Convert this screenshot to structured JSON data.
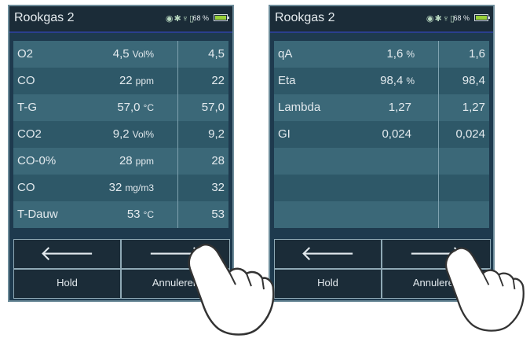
{
  "left": {
    "title": "Rookgas 2",
    "status_icons": "◉✱♆▯",
    "battery_pct": "68 %",
    "rows": [
      {
        "name": "O2",
        "value": "4,5",
        "unit": "Vol%",
        "num": "4,5"
      },
      {
        "name": "CO",
        "value": "22",
        "unit": "ppm",
        "num": "22"
      },
      {
        "name": "T-G",
        "value": "57,0",
        "unit": "°C",
        "num": "57,0"
      },
      {
        "name": "CO2",
        "value": "9,2",
        "unit": "Vol%",
        "num": "9,2"
      },
      {
        "name": "CO-0%",
        "value": "28",
        "unit": "ppm",
        "num": "28"
      },
      {
        "name": "CO",
        "value": "32",
        "unit": "mg/m3",
        "num": "32"
      },
      {
        "name": "T-Dauw",
        "value": "53",
        "unit": "°C",
        "num": "53"
      }
    ],
    "buttons": {
      "back": "🡐",
      "forward": "🡒",
      "hold": "Hold",
      "cancel": "Annuleren"
    }
  },
  "right": {
    "title": "Rookgas 2",
    "status_icons": "◉✱♆▯",
    "battery_pct": "68 %",
    "rows": [
      {
        "name": "qA",
        "value": "1,6",
        "unit": "%",
        "num": "1,6"
      },
      {
        "name": "Eta",
        "value": "98,4",
        "unit": "%",
        "num": "98,4"
      },
      {
        "name": "Lambda",
        "value": "1,27",
        "unit": "",
        "num": "1,27"
      },
      {
        "name": "GI",
        "value": "0,024",
        "unit": "",
        "num": "0,024"
      },
      {
        "name": "",
        "value": "",
        "unit": "",
        "num": ""
      },
      {
        "name": "",
        "value": "",
        "unit": "",
        "num": ""
      },
      {
        "name": "",
        "value": "",
        "unit": "",
        "num": ""
      }
    ],
    "buttons": {
      "back": "🡐",
      "forward": "🡒",
      "hold": "Hold",
      "cancel": "Annuleren"
    }
  },
  "icons": [
    "bluetooth-icon",
    "usb-icon",
    "battery-icon",
    "arrow-left-icon",
    "arrow-right-icon",
    "pointing-hand-icon"
  ]
}
